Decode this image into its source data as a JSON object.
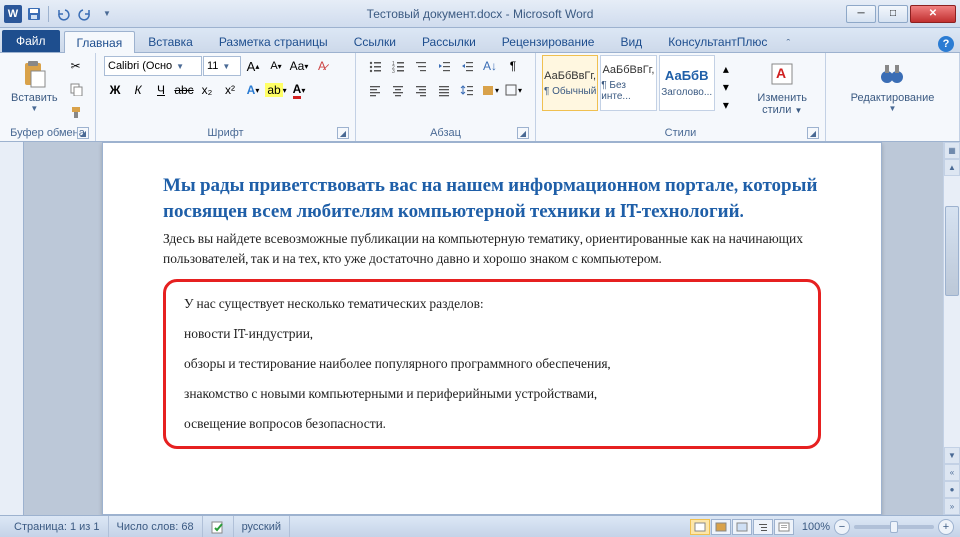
{
  "titlebar": {
    "title": "Тестовый документ.docx - Microsoft Word",
    "app_letter": "W"
  },
  "win": {
    "min": "─",
    "max": "□",
    "close": "✕"
  },
  "tabs": {
    "file": "Файл",
    "items": [
      "Главная",
      "Вставка",
      "Разметка страницы",
      "Ссылки",
      "Рассылки",
      "Рецензирование",
      "Вид",
      "КонсультантПлюс"
    ],
    "active_index": 0
  },
  "ribbon": {
    "clipboard": {
      "label": "Буфер обмена",
      "paste": "Вставить"
    },
    "font": {
      "label": "Шрифт",
      "name": "Calibri (Осно",
      "size": "11",
      "bold": "Ж",
      "italic": "К",
      "underline": "Ч",
      "strike": "abc",
      "sub": "x₂",
      "sup": "x²"
    },
    "paragraph": {
      "label": "Абзац"
    },
    "styles": {
      "label": "Стили",
      "items": [
        {
          "preview": "АаБбВвГг,",
          "name": "¶ Обычный"
        },
        {
          "preview": "АаБбВвГг,",
          "name": "¶ Без инте..."
        },
        {
          "preview": "АаБбВ",
          "name": "Заголово..."
        }
      ],
      "change": "Изменить стили"
    },
    "editing": {
      "label": "Редактирование"
    }
  },
  "document": {
    "heading": "Мы рады приветствовать вас на нашем информационном портале, который посвящен всем любителям компьютерной техники и IT-технологий.",
    "para1": "Здесь вы найдете всевозможные публикации на компьютерную тематику, ориентированные как на начинающих пользователей, так и на тех, кто уже достаточно давно и хорошо знаком с компьютером.",
    "framed": [
      "У нас существует несколько тематических разделов:",
      "новости IT-индустрии,",
      "обзоры и тестирование наиболее популярного программного обеспечения,",
      "знакомство с новыми компьютерными и периферийными устройствами,",
      "освещение вопросов безопасности."
    ]
  },
  "statusbar": {
    "page": "Страница: 1 из 1",
    "words": "Число слов: 68",
    "lang": "русский",
    "zoom": "100%"
  }
}
